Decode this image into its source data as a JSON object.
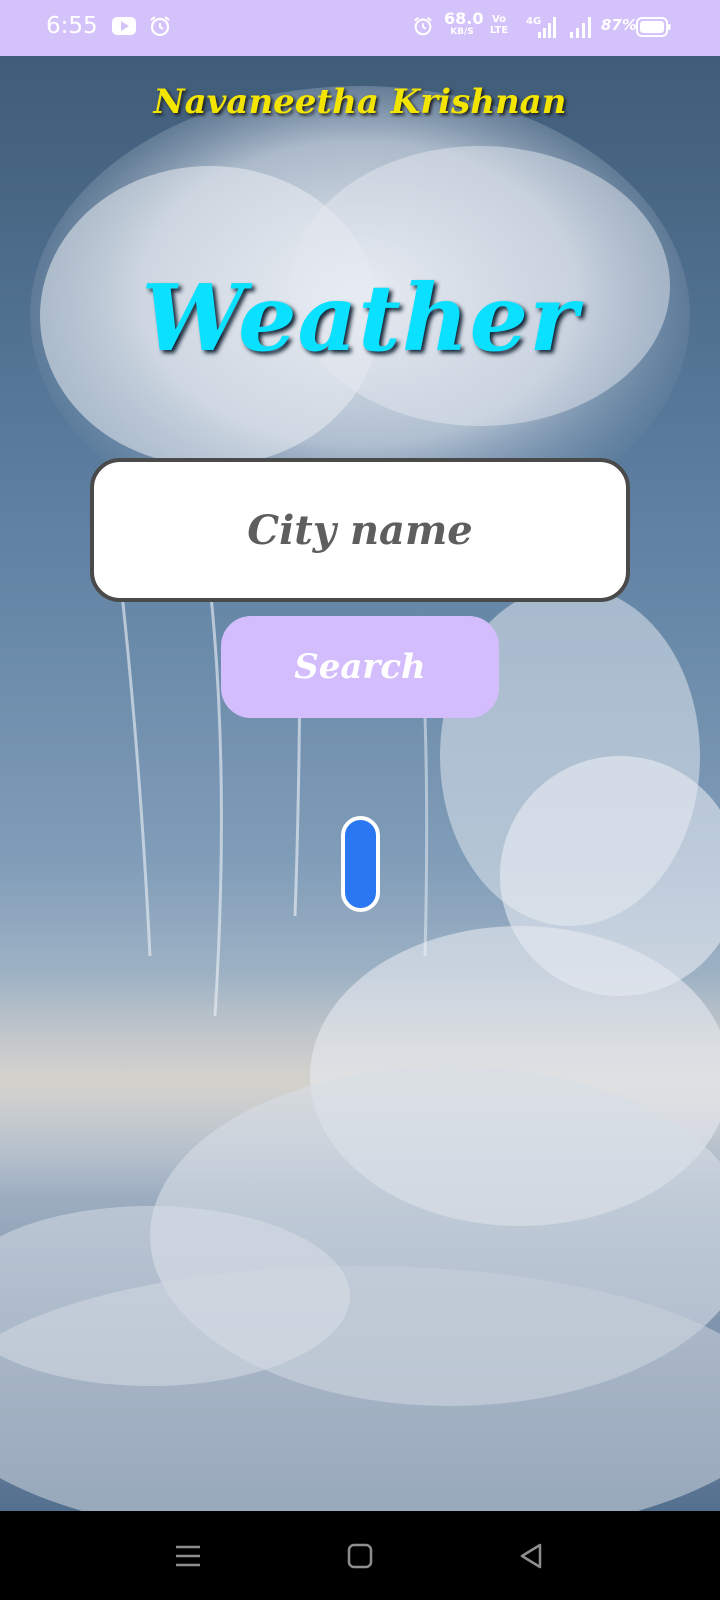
{
  "status_bar": {
    "time": "6:55",
    "network_speed_value": "68.0",
    "network_speed_unit": "KB/S",
    "volte_line1": "Vo",
    "volte_line2": "LTE",
    "network_type": "4G",
    "battery_percent": "87%",
    "background_color": "#d4c2fa"
  },
  "app": {
    "author": "Navaneetha Krishnan",
    "title": "Weather",
    "city_input": {
      "value": "",
      "placeholder": "City name"
    },
    "search_label": "Search",
    "colors": {
      "author": "#f3e500",
      "title": "#0ae0ff",
      "search_button": "#d4bdfc",
      "loader": "#2b77f2"
    }
  },
  "nav_bar": {
    "icons": [
      "menu-icon",
      "home-icon",
      "back-icon"
    ]
  }
}
